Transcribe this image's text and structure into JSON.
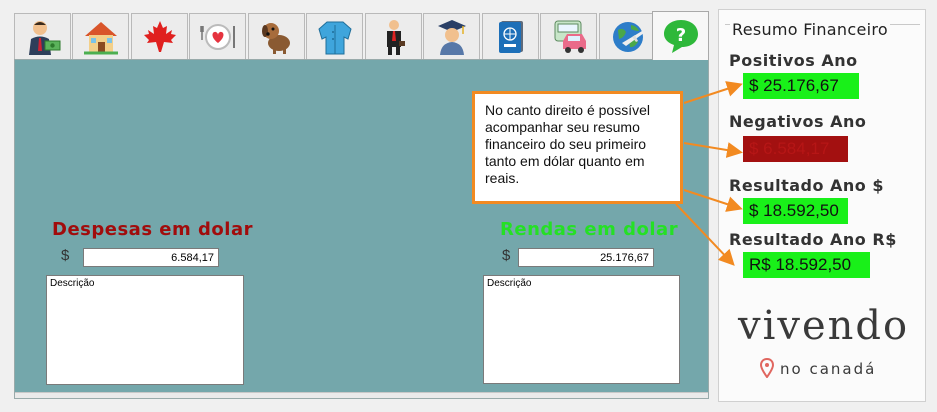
{
  "tabs": [
    {
      "icon": "money-person-icon"
    },
    {
      "icon": "house-icon"
    },
    {
      "icon": "maple-leaf-icon"
    },
    {
      "icon": "plate-heart-icon"
    },
    {
      "icon": "dog-icon"
    },
    {
      "icon": "coat-icon"
    },
    {
      "icon": "suit-icon"
    },
    {
      "icon": "graduate-icon"
    },
    {
      "icon": "passport-icon"
    },
    {
      "icon": "vehicle-icon"
    },
    {
      "icon": "globe-plane-icon"
    },
    {
      "icon": "help-icon",
      "active": true
    }
  ],
  "despesas": {
    "title": "Despesas em dolar",
    "currency": "$",
    "amount": "6.584,17",
    "description_label": "Descrição"
  },
  "rendas": {
    "title": "Rendas em dolar",
    "currency": "$",
    "amount": "25.176,67",
    "description_label": "Descrição"
  },
  "summary": {
    "title": "Resumo Financeiro",
    "positivos_label": "Positivos Ano",
    "positivos_value": "$ 25.176,67",
    "negativos_label": "Negativos Ano",
    "negativos_value": "$ 6.584,17",
    "resultado_usd_label": "Resultado Ano $",
    "resultado_usd_value": "$ 18.592,50",
    "resultado_brl_label": "Resultado Ano R$",
    "resultado_brl_value": "R$ 18.592,50"
  },
  "logo": {
    "main": "vivendo",
    "sub": "no canadá"
  },
  "callout": {
    "text": "No canto direito é possível acompanhar seu resumo financeiro do seu primeiro tanto em dólar quanto em reais."
  },
  "colors": {
    "panel_bg": "#74a7ab",
    "positive": "#19f019",
    "negative": "#a31010",
    "despesas_title": "#a10c0c",
    "rendas_title": "#25e025",
    "callout_border": "#f28a21"
  }
}
